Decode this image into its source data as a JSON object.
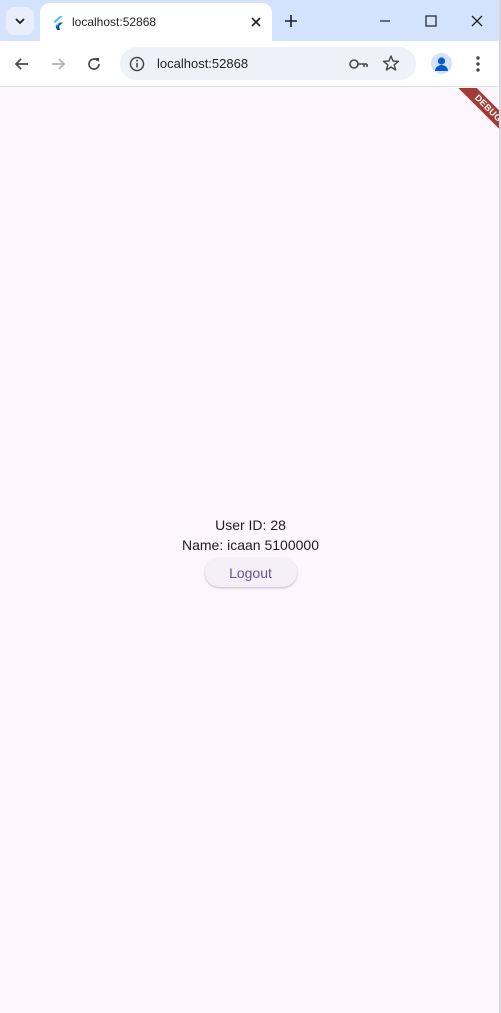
{
  "browser": {
    "tab": {
      "title": "localhost:52868"
    },
    "omnibox": {
      "url": "localhost:52868"
    }
  },
  "app": {
    "debug_banner": "DEBUG",
    "user_id_text": "User ID: 28",
    "name_text": "Name: icaan 5100000",
    "logout_label": "Logout"
  },
  "colors": {
    "page_bg": "#fdf7fd",
    "button_text": "#65558f",
    "debug_ribbon": "#a23b36",
    "tab_strip": "#d3e3fd"
  }
}
